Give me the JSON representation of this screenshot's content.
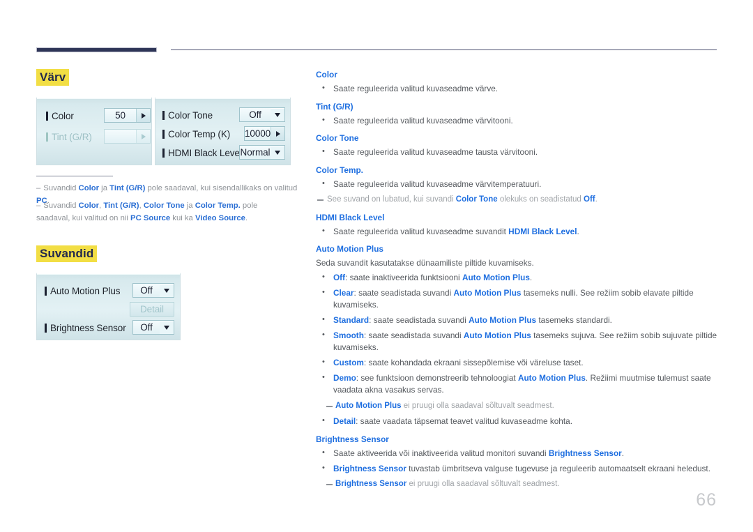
{
  "page_number": "66",
  "sections": [
    {
      "heading": "Värv",
      "osd": {
        "left_panel": {
          "rows": [
            {
              "label": "Color",
              "value": "50",
              "control": "stepper",
              "disabled": false
            },
            {
              "label": "Tint (G/R)",
              "value": "",
              "control": "stepper",
              "disabled": true
            }
          ]
        },
        "right_panel": {
          "rows": [
            {
              "label": "Color Tone",
              "value": "Off",
              "control": "dropdown",
              "disabled": false
            },
            {
              "label": "Color Temp (K)",
              "value": "10000",
              "control": "stepper",
              "disabled": false
            },
            {
              "label": "HDMI Black Level",
              "value": "Normal",
              "control": "dropdown",
              "disabled": false
            }
          ]
        }
      },
      "notes": [
        "Suvandid <b>Color</b> ja <b>Tint (G/R)</b> pole saadaval, kui sisendallikaks on valitud <b>PC</b>.",
        "Suvandid <b>Color</b>, <b>Tint (G/R)</b>, <b>Color Tone</b> ja <b>Color Temp.</b> pole saadaval, kui valitud on nii <b>PC Source</b> kui ka <b>Video Source</b>."
      ]
    },
    {
      "heading": "Suvandid",
      "osd": {
        "rows": [
          {
            "label": "Auto Motion Plus",
            "value": "Off",
            "control": "dropdown",
            "disabled": false
          },
          {
            "label": "Detail",
            "value": "",
            "control": "button",
            "disabled": true
          },
          {
            "label": "Brightness Sensor",
            "value": "Off",
            "control": "dropdown",
            "disabled": false
          }
        ],
        "detail_button_label": "Detail"
      }
    }
  ],
  "right_column": [
    {
      "type": "heading",
      "text": "Color"
    },
    {
      "type": "bullet",
      "html": "Saate reguleerida valitud kuvaseadme värve."
    },
    {
      "type": "heading",
      "text": "Tint (G/R)"
    },
    {
      "type": "bullet",
      "html": "Saate reguleerida valitud kuvaseadme värvitooni."
    },
    {
      "type": "heading",
      "text": "Color Tone"
    },
    {
      "type": "bullet",
      "html": "Saate reguleerida valitud kuvaseadme tausta värvitooni."
    },
    {
      "type": "heading",
      "text": "Color Temp."
    },
    {
      "type": "bullet",
      "html": "Saate reguleerida valitud kuvaseadme värvitemperatuuri."
    },
    {
      "type": "subnote",
      "html": "See suvand on lubatud, kui suvandi <b>Color Tone</b> olekuks on seadistatud <b>Off</b>.",
      "indent": "none"
    },
    {
      "type": "heading",
      "text": "HDMI Black Level"
    },
    {
      "type": "bullet",
      "html": "Saate reguleerida valitud kuvaseadme suvandit <b>HDMI Black Level</b>."
    },
    {
      "type": "heading",
      "text": "Auto Motion Plus"
    },
    {
      "type": "plain",
      "html": "Seda suvandit kasutatakse dünaamiliste piltide kuvamiseks."
    },
    {
      "type": "bullet",
      "html": "<b>Off</b>: saate inaktiveerida funktsiooni <b>Auto Motion Plus</b>."
    },
    {
      "type": "bullet",
      "html": "<b>Clear</b>: saate seadistada suvandi <b>Auto Motion Plus</b> tasemeks nulli. See režiim sobib elavate piltide kuvamiseks."
    },
    {
      "type": "bullet",
      "html": "<b>Standard</b>: saate seadistada suvandi <b>Auto Motion Plus</b> tasemeks standardi."
    },
    {
      "type": "bullet",
      "html": "<b>Smooth</b>: saate seadistada suvandi <b>Auto Motion Plus</b> tasemeks sujuva. See režiim sobib sujuvate piltide kuvamiseks."
    },
    {
      "type": "bullet",
      "html": "<b>Custom</b>: saate kohandada ekraani sissepõlemise või väreluse taset."
    },
    {
      "type": "bullet",
      "html": "<b>Demo</b>: see funktsioon demonstreerib tehnoloogiat <b>Auto Motion Plus</b>. Režiimi muutmise tulemust saate vaadata akna vasakus servas."
    },
    {
      "type": "subnote",
      "html": "<b>Auto Motion Plus</b> ei pruugi olla saadaval sõltuvalt seadmest.",
      "indent": "deep"
    },
    {
      "type": "bullet",
      "html": "<b>Detail</b>: saate vaadata täpsemat teavet valitud kuvaseadme kohta."
    },
    {
      "type": "heading",
      "text": "Brightness Sensor"
    },
    {
      "type": "bullet",
      "html": "Saate aktiveerida või inaktiveerida valitud monitori suvandi <b>Brightness Sensor</b>."
    },
    {
      "type": "bullet",
      "html": "<b>Brightness Sensor</b> tuvastab ümbritseva valguse tugevuse ja reguleerib automaatselt ekraani heledust."
    },
    {
      "type": "subnote",
      "html": "<b>Brightness Sensor</b> ei pruugi olla saadaval sõltuvalt seadmest.",
      "indent": "deep"
    }
  ],
  "colors": {
    "heading_highlight": "#f2de44",
    "heading_text": "#23294d",
    "link_blue": "#1f6fe0",
    "body_gray": "#55595e",
    "note_gray": "#8f9398",
    "rule_navy": "#2e3557",
    "osd_panel": "#dcecf0",
    "page_number": "#c7c9cc"
  }
}
